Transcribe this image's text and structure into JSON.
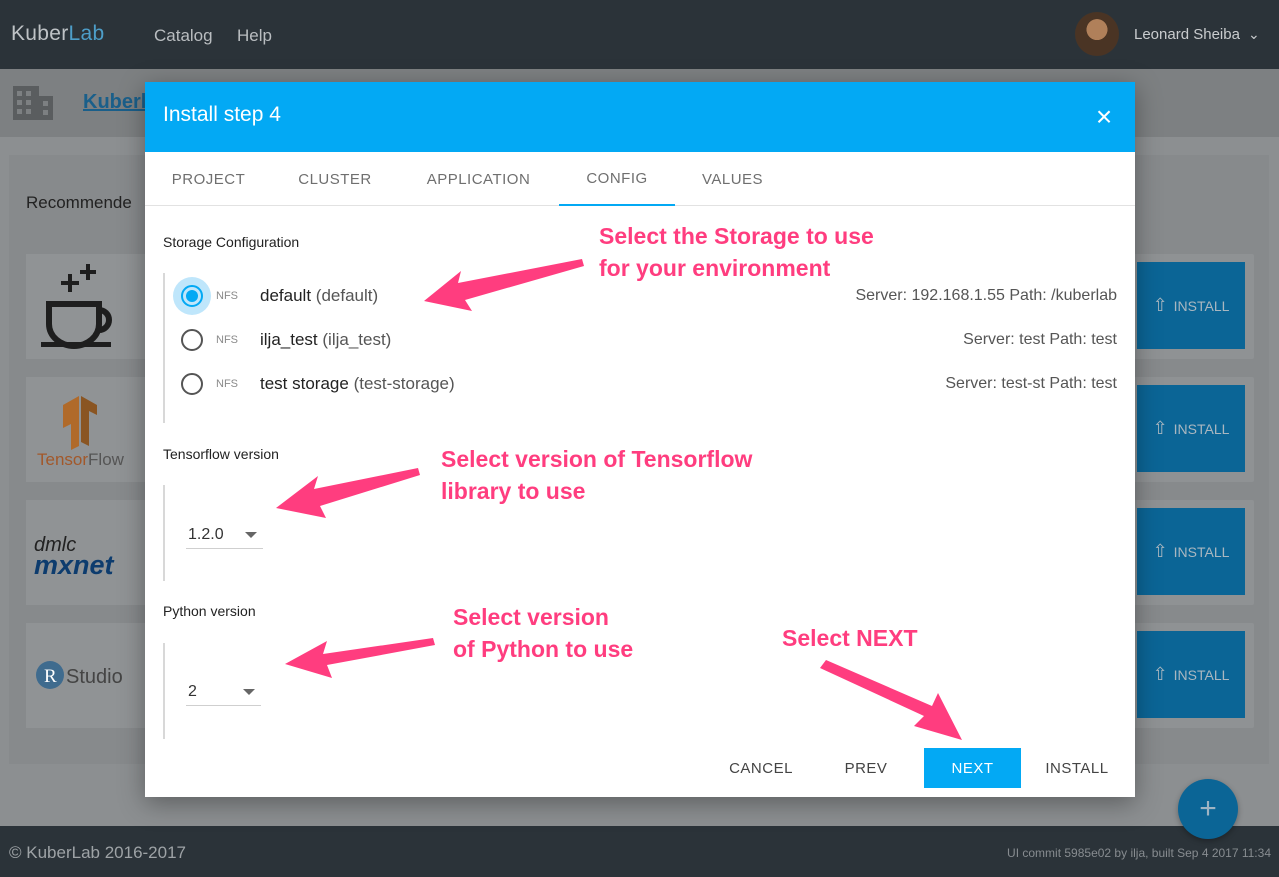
{
  "app": {
    "logo_part1": "Kuber",
    "logo_part2": "Lab",
    "nav": [
      "Catalog",
      "Help"
    ],
    "user_name": "Leonard Sheiba",
    "subbar_link": "Kuberl",
    "recommended_label": "Recommende",
    "app_cards": [
      {
        "name": "tensorflow-logo"
      },
      {
        "name": "tensorflow-logo"
      },
      {
        "name": "mxnet-logo"
      },
      {
        "name": "rstudio-logo"
      }
    ],
    "install_label": "INSTALL",
    "footer_copy": "© KuberLab 2016-2017",
    "footer_commit": "UI commit 5985e02 by ilja, built Sep 4 2017 11:34",
    "fab_label": "+"
  },
  "modal": {
    "title": "Install step 4",
    "close_label": "×",
    "tabs": [
      "PROJECT",
      "CLUSTER",
      "APPLICATION",
      "CONFIG",
      "VALUES"
    ],
    "active_tab": "CONFIG",
    "storage": {
      "label": "Storage Configuration",
      "options": [
        {
          "type": "NFS",
          "name": "default",
          "alias": "(default)",
          "info": "Server: 192.168.1.55 Path: /kuberlab",
          "selected": true
        },
        {
          "type": "NFS",
          "name": "ilja_test",
          "alias": "(ilja_test)",
          "info": "Server: test Path: test",
          "selected": false
        },
        {
          "type": "NFS",
          "name": "test storage",
          "alias": "(test-storage)",
          "info": "Server: test-st Path: test",
          "selected": false
        }
      ]
    },
    "tensorflow": {
      "label": "Tensorflow version",
      "value": "1.2.0"
    },
    "python": {
      "label": "Python version",
      "value": "2"
    },
    "buttons": {
      "cancel": "CANCEL",
      "prev": "PREV",
      "next": "NEXT",
      "install": "INSTALL"
    }
  },
  "annotations": {
    "storage": [
      "Select the Storage to use",
      "for your environment"
    ],
    "tensorflow": [
      "Select version of Tensorflow",
      "library to use"
    ],
    "python": [
      "Select version",
      "of Python to use"
    ],
    "next": [
      "Select NEXT"
    ]
  },
  "colors": {
    "accent": "#03a9f4",
    "annotation": "#ff3d7f",
    "topbar": "#2b3339"
  }
}
